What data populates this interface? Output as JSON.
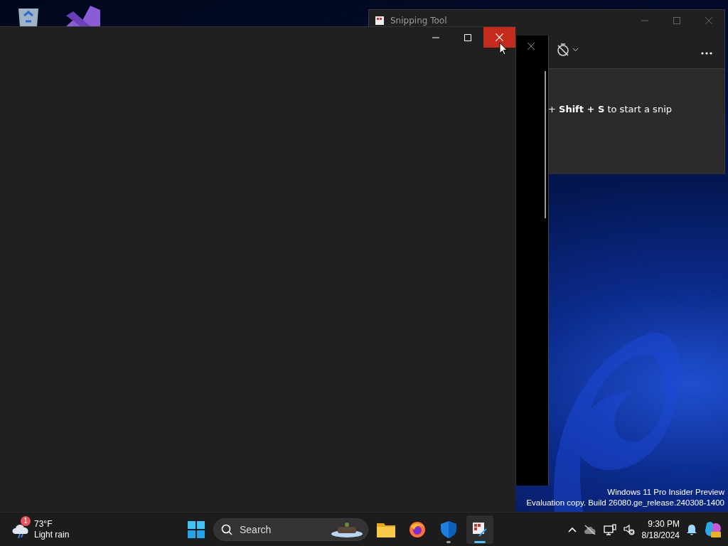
{
  "snipping_tool": {
    "title": "Snipping Tool",
    "hint": "+ **Shift + S** to start a snip"
  },
  "front_window": {
    "close_hovered": true
  },
  "desktop_text": [
    "Windows 11 Pro Insider Preview",
    "Evaluation copy. Build 26080.ge_release.240308-1400"
  ],
  "taskbar": {
    "weather": {
      "badge": "1",
      "temperature": "73°F",
      "condition": "Light rain"
    },
    "search": {
      "placeholder": "Search"
    },
    "apps": [
      {
        "kind": "folder",
        "running": false,
        "selected": false
      },
      {
        "kind": "browser",
        "running": false,
        "selected": false
      },
      {
        "kind": "shield",
        "running": true,
        "selected": false
      },
      {
        "kind": "snip",
        "running": true,
        "selected": true
      }
    ],
    "clock": {
      "time": "9:30 PM",
      "date": "8/18/2024"
    }
  }
}
